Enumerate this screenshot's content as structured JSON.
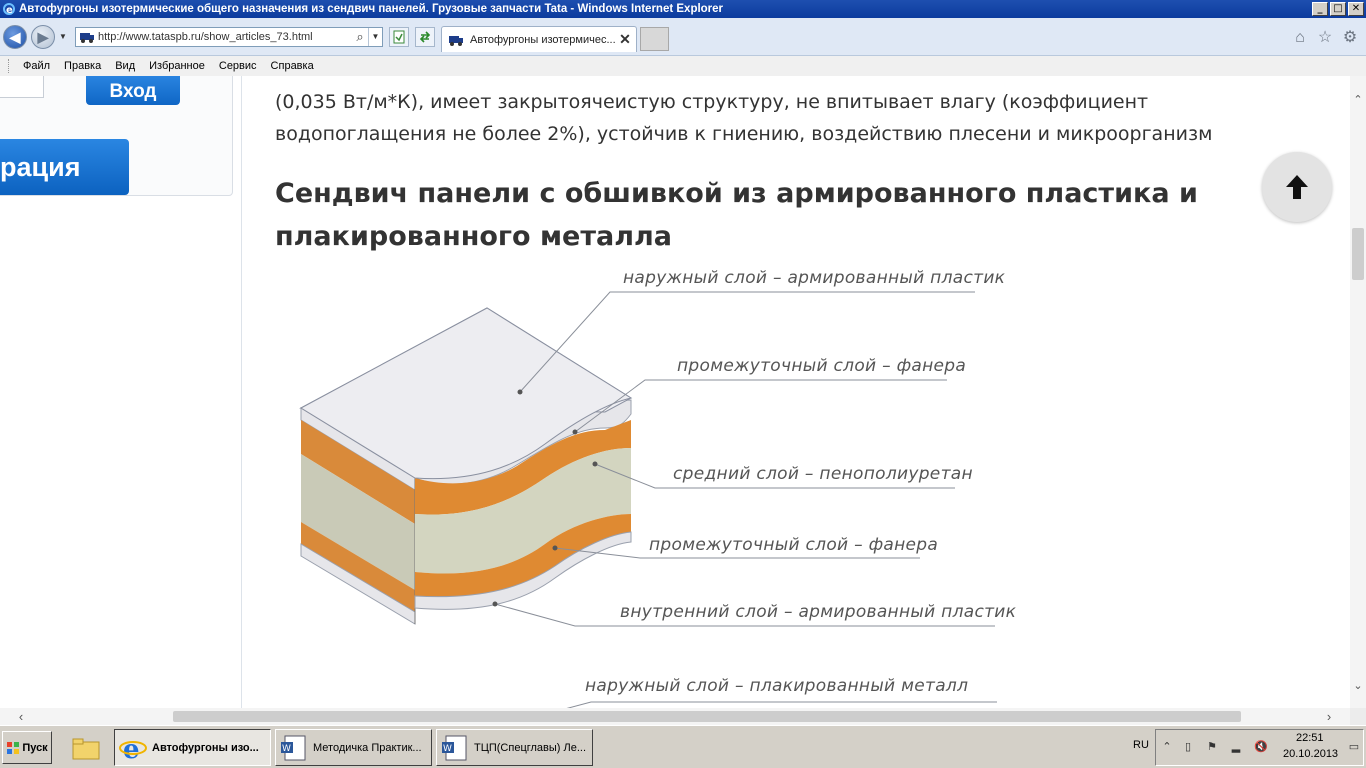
{
  "window": {
    "title": "Автофургоны изотермические общего назначения из сендвич панелей. Грузовые запчасти Tata - Windows Internet Explorer",
    "minimize_glyph": "_",
    "maximize_glyph": "□",
    "close_glyph": "✕"
  },
  "address_bar": {
    "url": "http://www.tataspb.ru/show_articles_73.html"
  },
  "tab": {
    "label": "Автофургоны изотермичес...",
    "close_glyph": "✕"
  },
  "menu": {
    "items": [
      "Файл",
      "Правка",
      "Вид",
      "Избранное",
      "Сервис",
      "Справка"
    ]
  },
  "sidebar": {
    "login_label": "Вход",
    "register_label": "рация"
  },
  "article": {
    "paragraph_lines": [
      "(0,035 Вт/м*К), имеет закрытоячеистую структуру, не впитывает влагу (коэффициент",
      "водопоглащения не более 2%), устойчив к гниению, воздействию плесени и микроорганизм"
    ],
    "heading_lines": [
      "Сендвич панели с обшивкой из армированного пластика и",
      "плакированного металла"
    ],
    "figure1_labels": [
      "наружный слой – армированный пластик",
      "промежуточный слой – фанера",
      "средний слой – пенополиуретан",
      "промежуточный слой – фанера",
      "внутренний слой – армированный пластик"
    ],
    "figure2_label": "наружный слой – плакированный металл"
  },
  "taskbar": {
    "start_label": "Пуск",
    "tasks": [
      {
        "label": "Автофургоны изо...",
        "active": true
      },
      {
        "label": "Методичка Практик...",
        "active": false
      },
      {
        "label": "ТЦП(Спецглавы) Ле...",
        "active": false
      }
    ],
    "language": "RU",
    "time": "22:51",
    "date": "20.10.2013"
  },
  "colors": {
    "accent_blue": "#0f66c5",
    "title_bar": "#0c3b9e",
    "orange_layer": "#e08a2a",
    "foam_layer": "#d3d5c0",
    "text": "#333333"
  }
}
